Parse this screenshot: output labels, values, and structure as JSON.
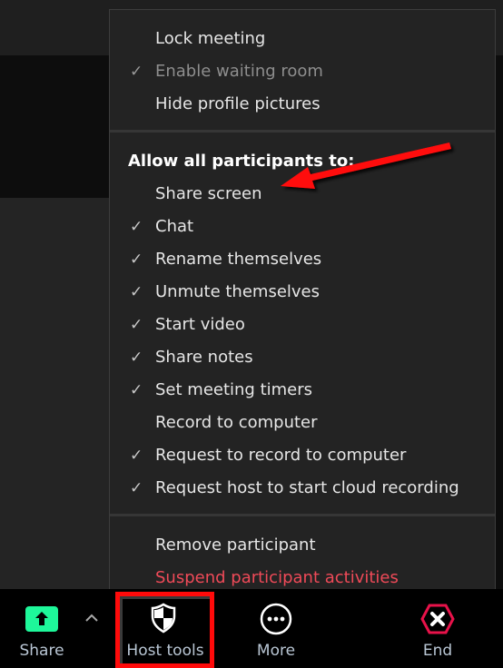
{
  "menu": {
    "section1": [
      {
        "label": "Lock meeting",
        "checked": false,
        "disabled": false
      },
      {
        "label": "Enable waiting room",
        "checked": true,
        "disabled": true
      },
      {
        "label": "Hide profile pictures",
        "checked": false,
        "disabled": false
      }
    ],
    "section2_heading": "Allow all participants to:",
    "section2": [
      {
        "label": "Share screen",
        "checked": false
      },
      {
        "label": "Chat",
        "checked": true
      },
      {
        "label": "Rename themselves",
        "checked": true
      },
      {
        "label": "Unmute themselves",
        "checked": true
      },
      {
        "label": "Start video",
        "checked": true
      },
      {
        "label": "Share notes",
        "checked": true
      },
      {
        "label": "Set meeting timers",
        "checked": true
      },
      {
        "label": "Record to computer",
        "checked": false
      },
      {
        "label": "Request to record to computer",
        "checked": true
      },
      {
        "label": "Request host to start cloud recording",
        "checked": true
      }
    ],
    "section3": [
      {
        "label": "Remove participant"
      },
      {
        "label": "Suspend participant activities",
        "danger": true
      }
    ],
    "check_glyph": "✓"
  },
  "toolbar": {
    "share_label": "Share",
    "host_tools_label": "Host tools",
    "more_label": "More",
    "end_label": "End",
    "share_icon": "upload-arrow-icon",
    "host_tools_icon": "shield-icon",
    "more_icon": "ellipsis-circle-icon",
    "end_icon": "close-hexagon-icon",
    "caret_icon": "chevron-up-icon"
  },
  "colors": {
    "share_accent": "#1ef79a",
    "end_accent": "#e8124a",
    "danger_text": "#ef4a58",
    "annotation_red": "#ff0a0a"
  },
  "annotation": {
    "arrow_points_to": "Share screen",
    "highlight_target": "Host tools"
  }
}
